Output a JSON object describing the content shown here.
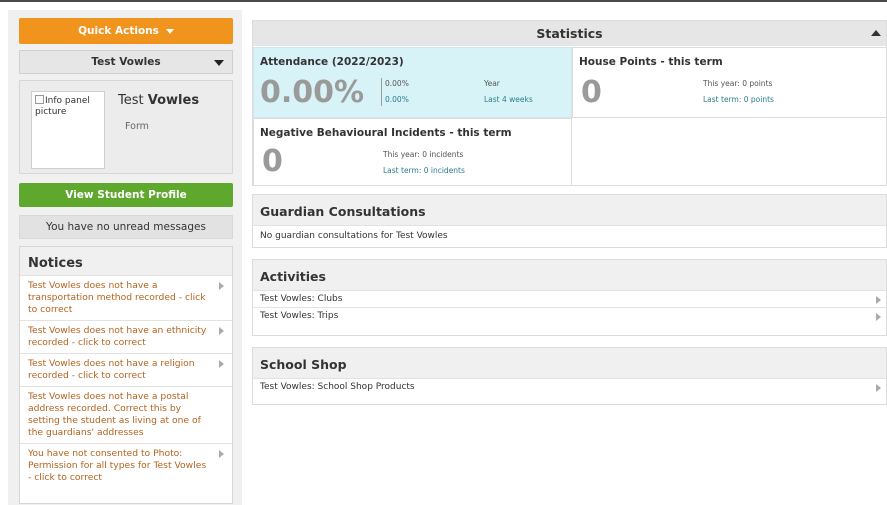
{
  "left": {
    "quick_actions": "Quick Actions",
    "student_select": "Test Vowles",
    "info_panel": {
      "picture_alt": "Info panel picture",
      "name_first": "Test",
      "name_last": "Vowles",
      "form_label": "Form"
    },
    "view_profile": "View Student Profile",
    "messages": "You have no unread messages",
    "notices": {
      "title": "Notices",
      "items": [
        {
          "text": "Test Vowles does not have a transportation method recorded - click to correct",
          "has_arrow": true
        },
        {
          "text": "Test Vowles does not have an ethnicity recorded - click to correct",
          "has_arrow": true
        },
        {
          "text": "Test Vowles does not have a religion recorded - click to correct",
          "has_arrow": true
        },
        {
          "text": "Test Vowles does not have a postal address recorded. Correct this by setting the student as living at one of the guardians' addresses",
          "has_arrow": false
        },
        {
          "text": "You have not consented to Photo: Permission for all types for Test Vowles - click to correct",
          "has_arrow": true
        }
      ]
    }
  },
  "statistics": {
    "title": "Statistics",
    "attendance": {
      "title": "Attendance (2022/2023)",
      "value": "0.00%",
      "year_value": "0.00%",
      "year_label": "Year",
      "last4_value": "0.00%",
      "last4_label": "Last 4 weeks"
    },
    "house_points": {
      "title": "House Points - this term",
      "value": "0",
      "this_year": "This year: 0 points",
      "last_term": "Last term: 0 points"
    },
    "negative": {
      "title": "Negative Behavioural Incidents - this term",
      "value": "0",
      "this_year": "This year: 0 incidents",
      "last_term": "Last term: 0 incidents"
    }
  },
  "guardian": {
    "title": "Guardian Consultations",
    "text": "No guardian consultations for Test Vowles"
  },
  "activities": {
    "title": "Activities",
    "rows": [
      "Test Vowles: Clubs",
      "Test Vowles: Trips"
    ]
  },
  "shop": {
    "title": "School Shop",
    "rows": [
      "Test Vowles: School Shop Products"
    ]
  },
  "colors": {
    "quick_actions": "#f0941e",
    "view_profile": "#5fa82e",
    "attendance_bg": "#d8f3f8",
    "notice_text": "#b3631e"
  }
}
